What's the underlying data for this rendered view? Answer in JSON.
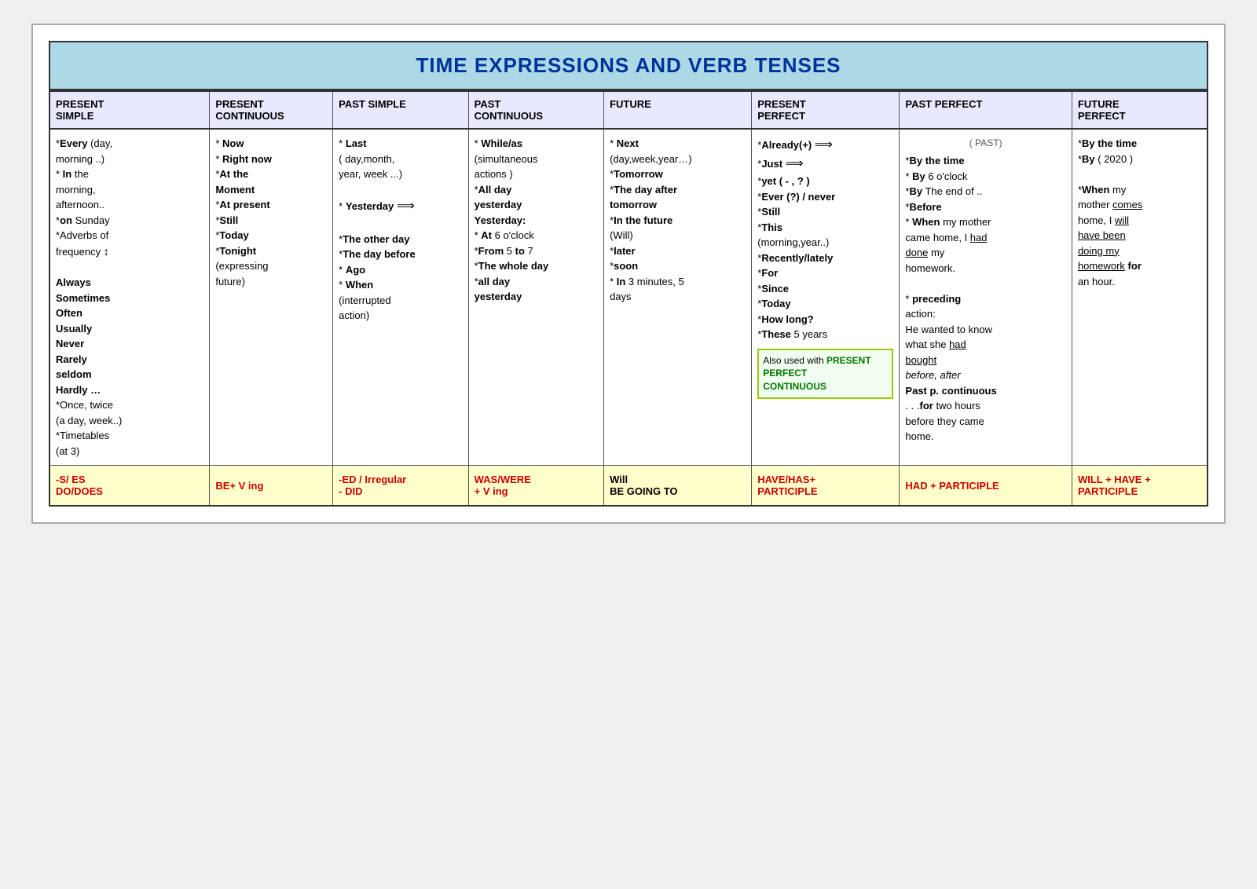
{
  "title": "TIME EXPRESSIONS AND VERB TENSES",
  "columns": [
    {
      "id": "present-simple",
      "line1": "PRESENT",
      "line2": "SIMPLE"
    },
    {
      "id": "present-continuous",
      "line1": "PRESENT",
      "line2": "CONTINUOUS"
    },
    {
      "id": "past-simple",
      "line1": "PAST SIMPLE",
      "line2": ""
    },
    {
      "id": "past-continuous",
      "line1": "PAST",
      "line2": "CONTINUOUS"
    },
    {
      "id": "future",
      "line1": "FUTURE",
      "line2": ""
    },
    {
      "id": "present-perfect",
      "line1": "PRESENT",
      "line2": "PERFECT"
    },
    {
      "id": "past-perfect",
      "line1": "PAST PERFECT",
      "line2": ""
    },
    {
      "id": "future-perfect",
      "line1": "FUTURE",
      "line2": "PERFECT"
    }
  ],
  "footer": {
    "present_simple": "-S/ ES\nDO/DOES",
    "present_continuous": "BE+ V ing",
    "past_simple": "-ED / Irregular\n- DID",
    "past_continuous": "WAS/WERE\n+ V ing",
    "future": "Will\nBE GOING TO",
    "present_perfect": "HAVE/HAS+\nPARTICIPLE",
    "past_perfect": "HAD + PARTICIPLE",
    "future_perfect": "WILL + HAVE +\nPARTICIPLE"
  }
}
